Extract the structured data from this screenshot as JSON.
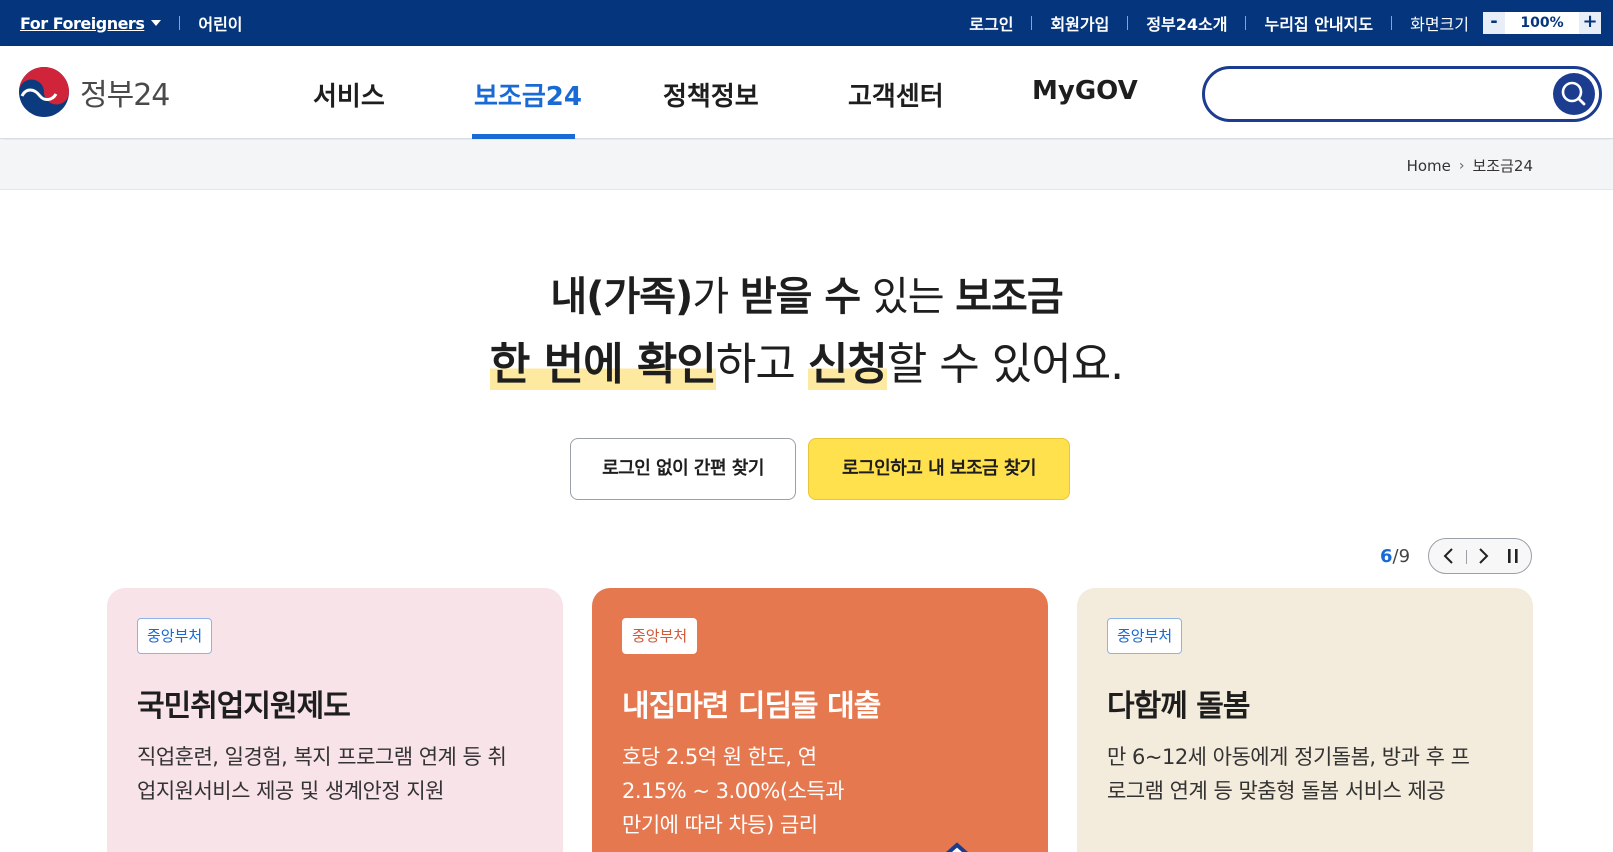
{
  "topbar": {
    "foreigners_label": "For Foreigners",
    "kids_label": "어린이",
    "links": [
      "로그인",
      "회원가입",
      "정부24소개",
      "누리집 안내지도"
    ],
    "zoom_label": "화면크기",
    "zoom_minus": "-",
    "zoom_value": "100%",
    "zoom_plus": "+"
  },
  "header": {
    "logo_text": "정부24",
    "nav": [
      "서비스",
      "보조금24",
      "정책정보",
      "고객센터",
      "MyGOV"
    ],
    "active_nav": "보조금24",
    "search_placeholder": ""
  },
  "breadcrumb": {
    "home": "Home",
    "current": "보조금24"
  },
  "hero": {
    "line1": {
      "p1": "내(가족)",
      "p2": "가 ",
      "p3": "받을 수",
      "p4": " 있는 ",
      "p5": "보조금"
    },
    "line2": {
      "p1": "한 번에 확인",
      "p2": "하고 ",
      "p3": "신청",
      "p4": "할 수 있어요."
    },
    "btn_guest": "로그인 없이 간편 찾기",
    "btn_login": "로그인하고 내 보조금 찾기"
  },
  "pager": {
    "current": "6",
    "separator": "/",
    "total": "9"
  },
  "cards": [
    {
      "tag": "중앙부처",
      "title": "국민취업지원제도",
      "desc": "직업훈련, 일경험, 복지 프로그램 연계 등 취업지원서비스 제공 및 생계안정 지원"
    },
    {
      "tag": "중앙부처",
      "title": "내집마련 디딤돌 대출",
      "desc": "호당 2.5억 원 한도, 연 2.15% ~ 3.00%(소득과 만기에 따라 차등) 금리"
    },
    {
      "tag": "중앙부처",
      "title": "다함께 돌봄",
      "desc": "만 6~12세 아동에게 정기돌봄, 방과 후 프로그램 연계 등 맞춤형 돌봄 서비스 제공"
    }
  ],
  "colors": {
    "topbar_bg": "#04357d",
    "accent_blue": "#1a6ad5",
    "search_border": "#1c3d8f",
    "cta_yellow": "#ffe04d",
    "card1_bg": "#f8e3e9",
    "card2_bg": "#e6784f",
    "card3_bg": "#f3ebdb"
  },
  "icons": {
    "logo": "taegeuk-logo-icon",
    "search": "search-icon",
    "dropdown": "caret-down-icon",
    "prev": "chevron-left-icon",
    "next": "chevron-right-icon",
    "pause": "pause-icon"
  }
}
